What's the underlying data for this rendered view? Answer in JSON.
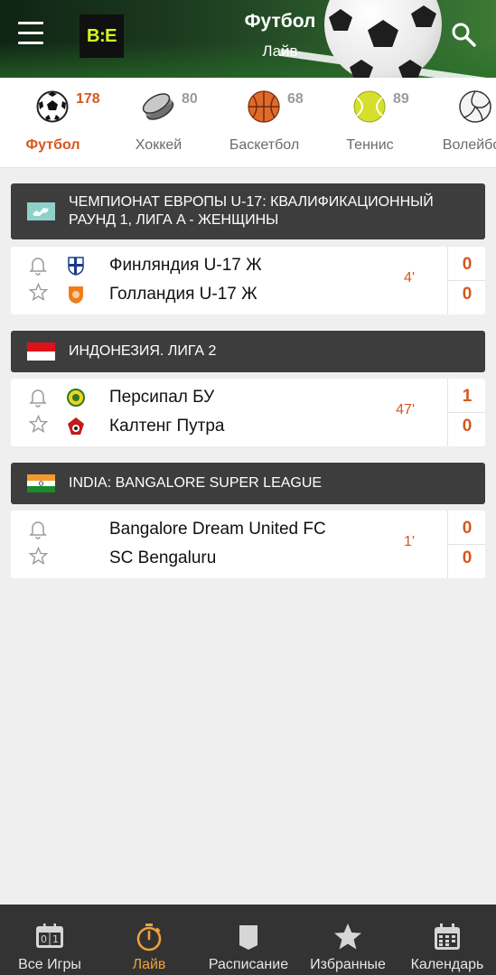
{
  "header": {
    "title": "Футбол",
    "subtitle": "Лайв",
    "logo_text": "B:E",
    "menu_icon": "hamburger-menu-icon",
    "search_icon": "search-icon"
  },
  "sports_tabs": [
    {
      "label": "Футбол",
      "count": "178",
      "icon": "soccer-ball-icon",
      "active": true
    },
    {
      "label": "Хоккей",
      "count": "80",
      "icon": "hockey-puck-icon",
      "active": false
    },
    {
      "label": "Баскетбол",
      "count": "68",
      "icon": "basketball-icon",
      "active": false
    },
    {
      "label": "Теннис",
      "count": "89",
      "icon": "tennis-ball-icon",
      "active": false
    },
    {
      "label": "Волейбол",
      "count": "",
      "icon": "volleyball-icon",
      "active": false
    }
  ],
  "leagues": [
    {
      "name": "ЧЕМПИОНАТ ЕВРОПЫ U-17: КВАЛИФИКАЦИОННЫЙ РАУНД 1, ЛИГА A - ЖЕНЩИНЫ",
      "flag": "europe-flag-icon",
      "matches": [
        {
          "team1": "Финляндия U-17 Ж",
          "team2": "Голландия U-17 Ж",
          "minute": "4'",
          "score1": "0",
          "score2": "0"
        }
      ]
    },
    {
      "name": "ИНДОНЕЗИЯ. ЛИГА 2",
      "flag": "indonesia-flag-icon",
      "matches": [
        {
          "team1": "Персипал БУ",
          "team2": "Калтенг Путра",
          "minute": "47'",
          "score1": "1",
          "score2": "0"
        }
      ]
    },
    {
      "name": "INDIA: BANGALORE SUPER LEAGUE",
      "flag": "india-flag-icon",
      "matches": [
        {
          "team1": "Bangalore Dream United FC",
          "team2": "SC Bengaluru",
          "minute": "1'",
          "score1": "0",
          "score2": "0"
        }
      ]
    }
  ],
  "bottom_nav": [
    {
      "label": "Все Игры",
      "icon": "scoreboard-icon",
      "active": false
    },
    {
      "label": "Лайв",
      "icon": "stopwatch-icon",
      "active": true
    },
    {
      "label": "Расписание",
      "icon": "schedule-icon",
      "active": false
    },
    {
      "label": "Избранные",
      "icon": "star-icon",
      "active": false
    },
    {
      "label": "Календарь",
      "icon": "calendar-icon",
      "active": false
    }
  ],
  "colors": {
    "accent": "#d6571f",
    "nav_active": "#f0a13a",
    "league_header_bg": "#3d3d3d",
    "bottom_nav_bg": "#333333"
  }
}
